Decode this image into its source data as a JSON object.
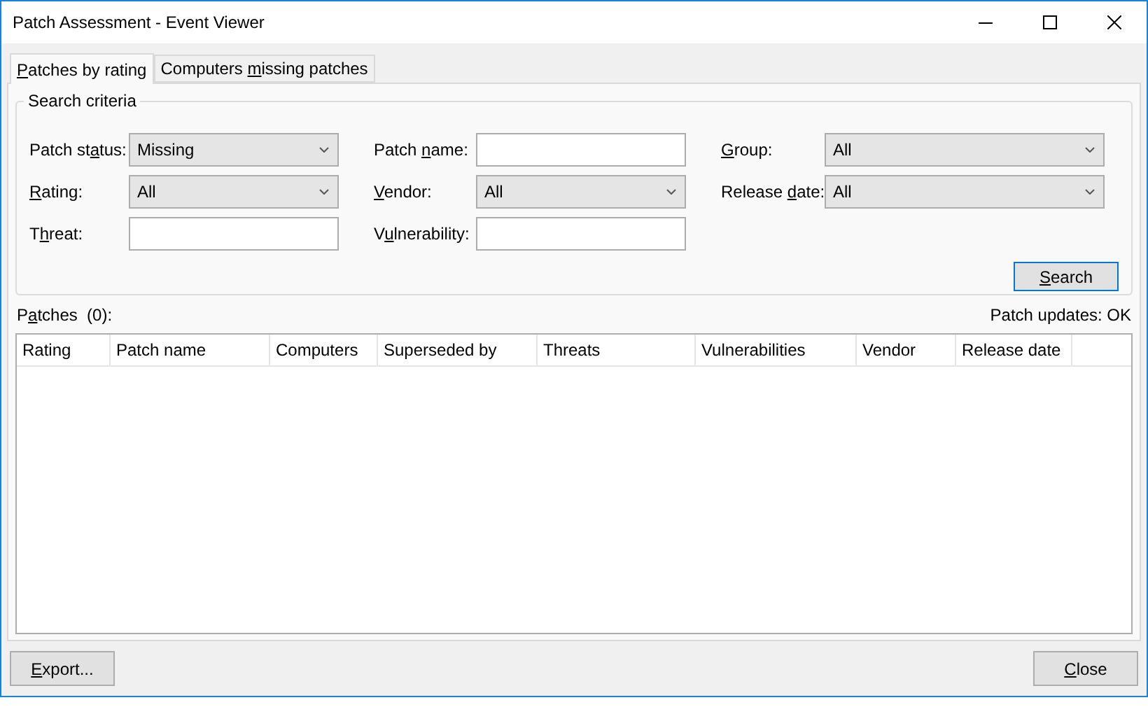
{
  "window": {
    "title": "Patch Assessment - Event Viewer"
  },
  "tabs": [
    {
      "label": {
        "key": "P",
        "after": "atches by rating"
      },
      "selected": true
    },
    {
      "label": {
        "before": "Computers ",
        "key": "m",
        "after": "issing patches"
      },
      "selected": false
    }
  ],
  "search_criteria": {
    "title": "Search criteria",
    "fields": [
      {
        "kind": "dropdown",
        "label": {
          "before": "Patch st",
          "key": "a",
          "after": "tus:"
        },
        "value": "Missing"
      },
      {
        "kind": "text",
        "label": {
          "before": "Patch ",
          "key": "n",
          "after": "ame:"
        }
      },
      {
        "kind": "dropdown",
        "label": {
          "key": "G",
          "after": "roup:"
        },
        "value": "All"
      },
      {
        "kind": "dropdown",
        "label": {
          "key": "R",
          "after": "ating:"
        },
        "value": "All"
      },
      {
        "kind": "dropdown",
        "label": {
          "key": "V",
          "after": "endor:"
        },
        "value": "All"
      },
      {
        "kind": "dropdown",
        "label": {
          "before": "Release ",
          "key": "d",
          "after": "ate:"
        },
        "value": "All"
      },
      {
        "kind": "text",
        "label": {
          "before": "T",
          "key": "h",
          "after": "reat:"
        }
      },
      {
        "kind": "text",
        "label": {
          "before": "V",
          "key": "u",
          "after": "lnerability:"
        }
      }
    ],
    "search_button": {
      "label": {
        "key": "S",
        "after": "earch"
      }
    }
  },
  "patches_label": {
    "label": {
      "before": "P",
      "key": "a",
      "after": "tches  (0):"
    }
  },
  "patch_updates": "Patch updates: OK",
  "table": {
    "columns": [
      "Rating",
      "Patch name",
      "Computers",
      "Superseded by",
      "Threats",
      "Vulnerabilities",
      "Vendor",
      "Release date"
    ]
  },
  "buttons": [
    {
      "label": {
        "key": "E",
        "after": "xport..."
      }
    },
    {
      "label": {
        "key": "C",
        "after": "lose"
      }
    }
  ]
}
